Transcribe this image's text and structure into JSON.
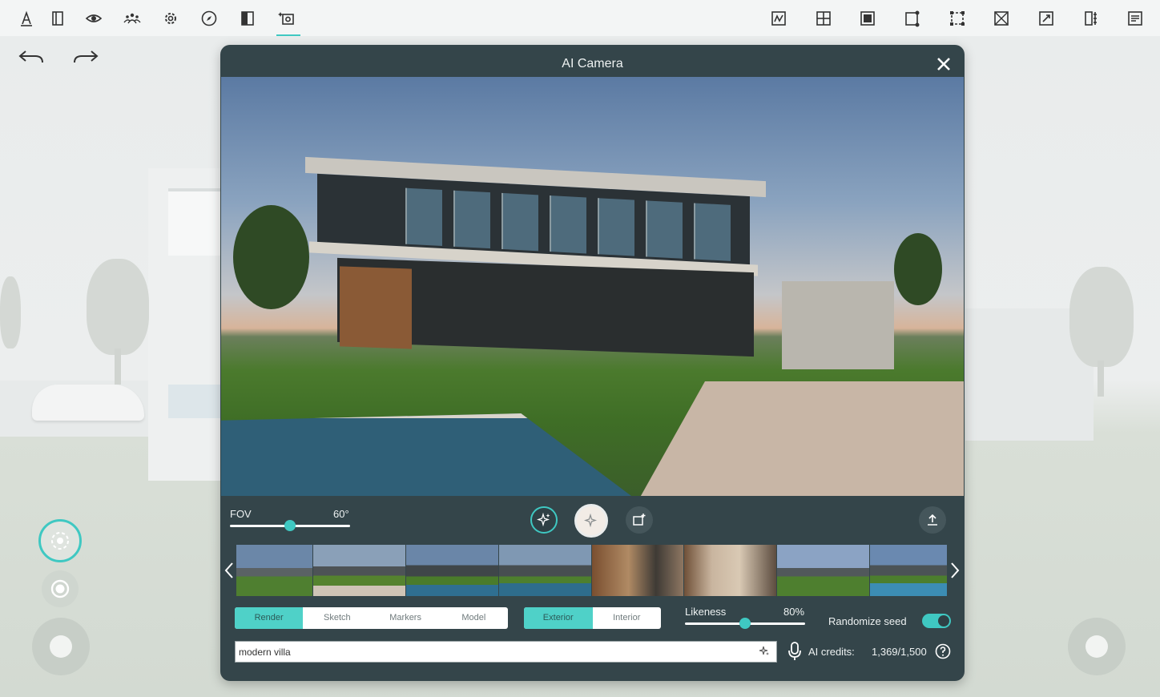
{
  "toolbar": {
    "icons": [
      "text-tool-icon",
      "layers-icon",
      "eye-icon",
      "people-icon",
      "gear-icon",
      "compass-icon",
      "split-view-icon",
      "ai-camera-icon"
    ],
    "right_icons": [
      "draw-icon",
      "add-grid-icon",
      "fill-square-icon",
      "corner-edit-icon",
      "frame-icon",
      "cross-box-icon",
      "pin-icon",
      "ruler-icon",
      "document-icon"
    ],
    "active": "ai-camera-icon",
    "accent": "#3fc8c2"
  },
  "dialog": {
    "title": "AI Camera",
    "fov": {
      "label": "FOV",
      "value": "60°",
      "level": 0.5
    },
    "thumbnails": [
      {
        "scene": "exterior-day"
      },
      {
        "scene": "exterior-path"
      },
      {
        "scene": "exterior-pool"
      },
      {
        "scene": "exterior-pool-deck"
      },
      {
        "scene": "interior-dining"
      },
      {
        "scene": "interior-living"
      },
      {
        "scene": "exterior-lawn"
      },
      {
        "scene": "exterior-pool-wide"
      }
    ],
    "modes": [
      "Render",
      "Sketch",
      "Markers",
      "Model"
    ],
    "active_mode": "Render",
    "scene_types": [
      "Exterior",
      "Interior"
    ],
    "active_scene_type": "Exterior",
    "likeness": {
      "label": "Likeness",
      "value": "80%",
      "level": 0.5
    },
    "randomize_seed": {
      "label": "Randomize seed",
      "enabled": true
    },
    "prompt": {
      "value": "modern villa"
    },
    "credits": {
      "label": "AI credits:",
      "value": "1,369/1,500"
    }
  }
}
